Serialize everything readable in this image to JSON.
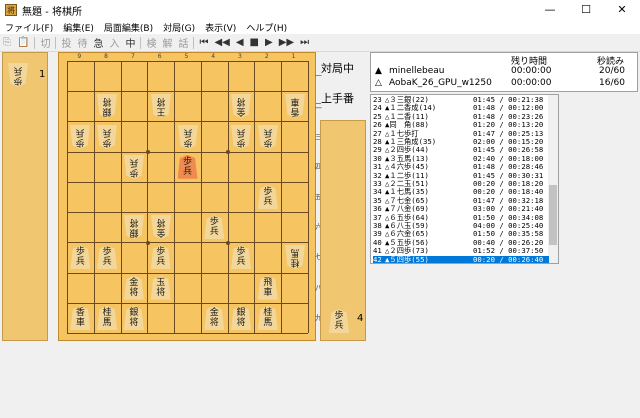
{
  "window": {
    "title": "無題 - 将棋所",
    "min_label": "—",
    "max_label": "☐",
    "close_label": "✕"
  },
  "menu": [
    "ファイル(F)",
    "編集(E)",
    "局面編集(B)",
    "対局(G)",
    "表示(V)",
    "ヘルプ(H)"
  ],
  "toolbar": {
    "buttons": [
      "切",
      "投",
      "待",
      "急",
      "入",
      "中",
      "検",
      "解",
      "話",
      "⏮",
      "◀◀",
      "◀",
      "■",
      "▶",
      "▶▶",
      "⏭"
    ]
  },
  "board": {
    "file_labels": [
      "9",
      "8",
      "7",
      "6",
      "5",
      "4",
      "3",
      "2",
      "1"
    ],
    "rank_labels": [
      "一",
      "二",
      "三",
      "四",
      "五",
      "六",
      "七",
      "八",
      "九"
    ],
    "pieces": [
      {
        "file": 8,
        "rank": 2,
        "text": "銀将",
        "side": "gote"
      },
      {
        "file": 6,
        "rank": 2,
        "text": "王将",
        "side": "gote"
      },
      {
        "file": 3,
        "rank": 2,
        "text": "金将",
        "side": "gote"
      },
      {
        "file": 1,
        "rank": 2,
        "text": "香車",
        "side": "gote"
      },
      {
        "file": 9,
        "rank": 3,
        "text": "歩兵",
        "side": "gote"
      },
      {
        "file": 8,
        "rank": 3,
        "text": "歩兵",
        "side": "gote"
      },
      {
        "file": 5,
        "rank": 3,
        "text": "歩兵",
        "side": "gote"
      },
      {
        "file": 3,
        "rank": 3,
        "text": "歩兵",
        "side": "gote"
      },
      {
        "file": 2,
        "rank": 3,
        "text": "歩兵",
        "side": "gote"
      },
      {
        "file": 7,
        "rank": 4,
        "text": "歩兵",
        "side": "gote"
      },
      {
        "file": 5,
        "rank": 4,
        "text": "歩兵",
        "side": "sente",
        "hl": true
      },
      {
        "file": 2,
        "rank": 5,
        "text": "歩兵",
        "side": "sente"
      },
      {
        "file": 7,
        "rank": 6,
        "text": "銀将",
        "side": "gote"
      },
      {
        "file": 6,
        "rank": 6,
        "text": "金将",
        "side": "gote"
      },
      {
        "file": 4,
        "rank": 6,
        "text": "歩兵",
        "side": "sente"
      },
      {
        "file": 9,
        "rank": 7,
        "text": "歩兵",
        "side": "sente"
      },
      {
        "file": 8,
        "rank": 7,
        "text": "歩兵",
        "side": "sente"
      },
      {
        "file": 6,
        "rank": 7,
        "text": "歩兵",
        "side": "sente"
      },
      {
        "file": 3,
        "rank": 7,
        "text": "歩兵",
        "side": "sente"
      },
      {
        "file": 1,
        "rank": 7,
        "text": "桂馬",
        "side": "gote"
      },
      {
        "file": 7,
        "rank": 8,
        "text": "金将",
        "side": "sente"
      },
      {
        "file": 6,
        "rank": 8,
        "text": "玉将",
        "side": "sente"
      },
      {
        "file": 2,
        "rank": 8,
        "text": "飛車",
        "side": "sente"
      },
      {
        "file": 9,
        "rank": 9,
        "text": "香車",
        "side": "sente"
      },
      {
        "file": 8,
        "rank": 9,
        "text": "桂馬",
        "side": "sente"
      },
      {
        "file": 7,
        "rank": 9,
        "text": "銀将",
        "side": "sente"
      },
      {
        "file": 4,
        "rank": 9,
        "text": "金将",
        "side": "sente"
      },
      {
        "file": 3,
        "rank": 9,
        "text": "銀将",
        "side": "sente"
      },
      {
        "file": 2,
        "rank": 9,
        "text": "桂馬",
        "side": "sente"
      }
    ]
  },
  "gote_hand": {
    "piece": "歩兵",
    "count": "1"
  },
  "sente_hand": {
    "piece": "歩兵",
    "count": "4"
  },
  "status": {
    "game": "対局中",
    "turn": "上手番"
  },
  "times": {
    "headers": [
      "残り時間",
      "秒読み"
    ],
    "players": [
      {
        "mark": "▲",
        "name": "minellebeau",
        "remaining": "00:00:00",
        "byoyomi": "20/60"
      },
      {
        "mark": "△",
        "name": "AobaK_26_GPU_w1250",
        "remaining": "00:00:00",
        "byoyomi": "16/60"
      }
    ]
  },
  "moves": [
    {
      "num": "23",
      "move": "△３三銀(22)",
      "time": "01:45 / 00:21:38"
    },
    {
      "num": "24",
      "move": "▲１二香成(14)",
      "time": "01:48 / 00:12:00"
    },
    {
      "num": "25",
      "move": "△１二香(11)",
      "time": "01:48 / 00:23:26"
    },
    {
      "num": "26",
      "move": "▲同　角(88)",
      "time": "01:20 / 00:13:20"
    },
    {
      "num": "27",
      "move": "△１七歩打",
      "time": "01:47 / 00:25:13"
    },
    {
      "num": "28",
      "move": "▲１三角成(35)",
      "time": "02:00 / 00:15:20"
    },
    {
      "num": "29",
      "move": "△２四歩(44)",
      "time": "01:45 / 00:26:58"
    },
    {
      "num": "30",
      "move": "▲３五馬(13)",
      "time": "02:40 / 00:18:00"
    },
    {
      "num": "31",
      "move": "△４六歩(45)",
      "time": "01:48 / 00:28:46"
    },
    {
      "num": "32",
      "move": "▲１二歩(11)",
      "time": "01:45 / 00:30:31"
    },
    {
      "num": "33",
      "move": "△２二玉(51)",
      "time": "00:20 / 00:18:20"
    },
    {
      "num": "34",
      "move": "▲１七馬(35)",
      "time": "00:20 / 00:18:40"
    },
    {
      "num": "35",
      "move": "△７七金(65)",
      "time": "01:47 / 00:32:18"
    },
    {
      "num": "36",
      "move": "▲７八金(69)",
      "time": "03:00 / 00:21:40"
    },
    {
      "num": "37",
      "move": "△６五歩(64)",
      "time": "01:50 / 00:34:08"
    },
    {
      "num": "38",
      "move": "▲６八玉(59)",
      "time": "04:00 / 00:25:40"
    },
    {
      "num": "39",
      "move": "△６六金(65)",
      "time": "01:50 / 00:35:58"
    },
    {
      "num": "40",
      "move": "▲５五歩(56)",
      "time": "00:40 / 00:26:20"
    },
    {
      "num": "41",
      "move": "△２四歩(73)",
      "time": "01:52 / 00:37:50"
    },
    {
      "num": "42",
      "move": "▲５四歩(55)",
      "time": "00:20 / 00:26:40"
    }
  ],
  "selected_move_index": 19
}
